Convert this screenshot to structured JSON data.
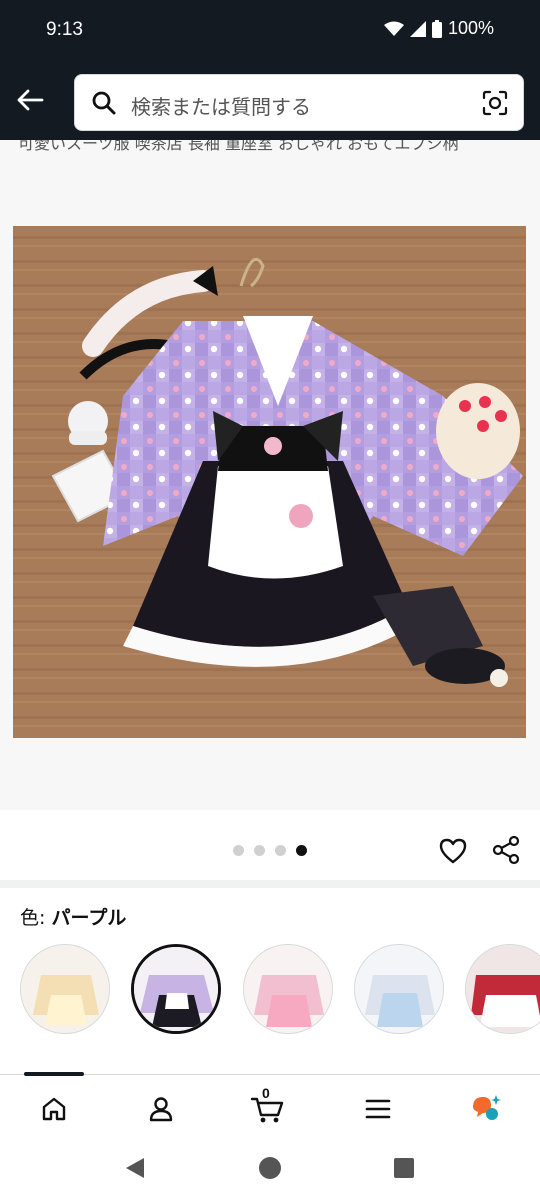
{
  "status": {
    "time": "9:13",
    "battery": "100%"
  },
  "search": {
    "placeholder": "検索または質問する"
  },
  "product": {
    "title_partial": "可愛いスーツ服 喫茶店 長袖 重座室 おしゃれ おもてエプシ柄"
  },
  "gallery": {
    "dots": 4,
    "active_index": 3
  },
  "variant": {
    "label": "色: ",
    "selected": "パープル",
    "swatches": [
      {
        "name": "yellow",
        "color": "#f3dfb3"
      },
      {
        "name": "purple",
        "color": "#c8b4e4"
      },
      {
        "name": "pink",
        "color": "#f2bfd0"
      },
      {
        "name": "blue",
        "color": "#bcd5ee"
      },
      {
        "name": "red",
        "color": "#c22a3a"
      }
    ]
  },
  "nav": {
    "cart_count": "0"
  },
  "colors": {
    "header": "#131a22",
    "accent": "#ff9900"
  }
}
